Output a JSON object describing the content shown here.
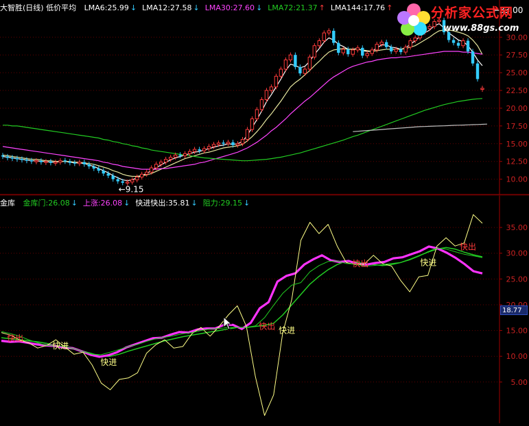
{
  "colors": {
    "background": "#000000",
    "axis": "#a00000",
    "grid": "#800000",
    "candle_up": "#ff3b3b",
    "candle_down": "#33ccff",
    "lma6": "#ffffff",
    "lma12": "#e8e8a0",
    "lma30": "#ff44ff",
    "lma72": "#22cc22",
    "lma144": "#c0c0c0",
    "gold_gate": "#22cc22",
    "rise": "#ff33ff",
    "fast_in": "#ffff88",
    "resistance": "#22cc22"
  },
  "top_header": {
    "title": "大智胜(日线) 低价平均",
    "items": [
      {
        "label": "LMA6:25.99",
        "color": "#ffffff",
        "arrow": "↓",
        "arrow_color": "#33ccff"
      },
      {
        "label": "LMA12:27.58",
        "color": "#ffffff",
        "arrow": "↓",
        "arrow_color": "#33ccff"
      },
      {
        "label": "LMA30:27.60",
        "color": "#ff44ff",
        "arrow": "↓",
        "arrow_color": "#33ccff"
      },
      {
        "label": "LMA72:21.37",
        "color": "#22cc22",
        "arrow": "↑",
        "arrow_color": "#ff3b3b"
      },
      {
        "label": "LMA144:17.76",
        "color": "#ffffff",
        "arrow": "↑",
        "arrow_color": "#ff3b3b"
      }
    ]
  },
  "bottom_header": {
    "title": "金库",
    "items": [
      {
        "label": "金库门:26.08",
        "color": "#22cc22",
        "arrow": "↓",
        "arrow_color": "#33ccff"
      },
      {
        "label": "上涨:26.08",
        "color": "#ff44ff",
        "arrow": "↓",
        "arrow_color": "#33ccff"
      },
      {
        "label": "快进快出:35.81",
        "color": "#ffffff",
        "arrow": "↓",
        "arrow_color": "#33ccff"
      },
      {
        "label": "阻力:29.15",
        "color": "#22cc22",
        "arrow": "↓",
        "arrow_color": "#33ccff"
      }
    ]
  },
  "logo": {
    "text": "分析家公式网",
    "url": "www.88gs.com"
  },
  "value_box": "18.77",
  "chart_data": [
    {
      "type": "line",
      "panel": "price",
      "title": "大智胜(日线) 低价平均",
      "ylim": [
        9.0,
        33.5
      ],
      "yticks": [
        "30.00",
        "27.50",
        "25.00",
        "22.50",
        "20.00",
        "17.50",
        "15.00",
        "12.50",
        "10.00"
      ],
      "ytick_values": [
        30.0,
        27.5,
        25.0,
        22.5,
        20.0,
        17.5,
        15.0,
        12.5,
        10.0
      ],
      "annotations": [
        {
          "text": "←9.15",
          "x_index": 25,
          "y": 9.15
        },
        {
          "text": "←33.00",
          "x_index": 103,
          "y": 33.0
        }
      ],
      "candles_close": [
        13.2,
        13.0,
        12.9,
        12.8,
        12.7,
        12.6,
        12.5,
        12.6,
        12.4,
        12.5,
        12.3,
        12.4,
        12.6,
        12.5,
        12.3,
        12.2,
        12.4,
        12.1,
        11.8,
        11.5,
        11.2,
        10.8,
        10.5,
        10.0,
        9.7,
        9.5,
        9.6,
        9.9,
        10.3,
        10.7,
        11.0,
        11.6,
        12.1,
        12.4,
        12.8,
        13.1,
        13.4,
        13.3,
        13.6,
        13.9,
        14.2,
        14.0,
        14.3,
        14.6,
        14.9,
        15.1,
        15.0,
        15.2,
        14.8,
        15.0,
        15.6,
        17.0,
        18.5,
        19.8,
        21.2,
        22.5,
        23.0,
        24.5,
        25.5,
        26.8,
        27.5,
        25.8,
        24.9,
        25.5,
        27.2,
        28.8,
        29.5,
        30.6,
        30.9,
        29.2,
        27.8,
        28.3,
        27.6,
        28.2,
        28.5,
        27.4,
        27.7,
        28.2,
        29.0,
        29.3,
        28.6,
        28.0,
        28.3,
        27.9,
        28.6,
        29.5,
        29.9,
        30.7,
        31.2,
        31.5,
        32.2,
        32.4,
        30.7,
        29.6,
        29.2,
        28.8,
        29.5,
        28.0,
        26.3,
        24.1,
        22.8
      ],
      "candles_dir": [
        "d",
        "d",
        "d",
        "d",
        "d",
        "d",
        "d",
        "u",
        "d",
        "u",
        "d",
        "u",
        "u",
        "d",
        "d",
        "d",
        "u",
        "d",
        "d",
        "d",
        "d",
        "d",
        "d",
        "d",
        "d",
        "d",
        "u",
        "u",
        "u",
        "u",
        "u",
        "u",
        "u",
        "u",
        "u",
        "u",
        "u",
        "d",
        "u",
        "u",
        "u",
        "d",
        "u",
        "u",
        "u",
        "u",
        "d",
        "u",
        "d",
        "u",
        "u",
        "u",
        "u",
        "u",
        "u",
        "u",
        "u",
        "u",
        "u",
        "u",
        "u",
        "d",
        "d",
        "u",
        "u",
        "u",
        "u",
        "u",
        "u",
        "d",
        "d",
        "u",
        "d",
        "u",
        "u",
        "d",
        "u",
        "u",
        "u",
        "u",
        "d",
        "d",
        "u",
        "d",
        "u",
        "u",
        "u",
        "u",
        "u",
        "u",
        "u",
        "u",
        "d",
        "d",
        "d",
        "d",
        "u",
        "d",
        "d",
        "d",
        "u"
      ],
      "series": [
        {
          "name": "LMA6",
          "values": [
            13.2,
            13.1,
            13.0,
            12.9,
            12.8,
            12.7,
            12.6,
            12.6,
            12.5,
            12.5,
            12.4,
            12.4,
            12.5,
            12.5,
            12.4,
            12.3,
            12.3,
            12.2,
            12.0,
            11.8,
            11.5,
            11.2,
            10.9,
            10.5,
            10.2,
            9.9,
            9.8,
            9.9,
            10.2,
            10.5,
            10.8,
            11.2,
            11.6,
            12.0,
            12.4,
            12.7,
            13.0,
            13.2,
            13.4,
            13.6,
            13.8,
            13.9,
            14.1,
            14.3,
            14.5,
            14.7,
            14.8,
            15.0,
            14.9,
            15.0,
            15.3,
            16.2,
            17.3,
            18.4,
            19.6,
            20.9,
            21.9,
            23.0,
            24.1,
            25.3,
            26.2,
            26.0,
            25.7,
            25.9,
            26.6,
            27.6,
            28.4,
            29.3,
            29.9,
            29.6,
            29.0,
            28.7,
            28.3,
            28.3,
            28.4,
            28.1,
            28.0,
            28.0,
            28.5,
            28.9,
            28.9,
            28.6,
            28.5,
            28.3,
            28.5,
            29.0,
            29.5,
            30.1,
            30.6,
            31.0,
            31.6,
            31.9,
            31.3,
            30.6,
            30.1,
            29.6,
            29.4,
            28.8,
            27.9,
            26.8,
            25.99
          ]
        },
        {
          "name": "LMA12",
          "values": [
            13.4,
            13.3,
            13.2,
            13.1,
            13.0,
            12.9,
            12.8,
            12.8,
            12.7,
            12.6,
            12.6,
            12.5,
            12.5,
            12.5,
            12.5,
            12.4,
            12.4,
            12.3,
            12.2,
            12.1,
            11.9,
            11.7,
            11.5,
            11.2,
            11.0,
            10.7,
            10.5,
            10.4,
            10.4,
            10.5,
            10.6,
            10.8,
            11.1,
            11.4,
            11.7,
            12.0,
            12.3,
            12.6,
            12.9,
            13.1,
            13.3,
            13.5,
            13.7,
            13.8,
            14.0,
            14.2,
            14.4,
            14.5,
            14.6,
            14.7,
            14.9,
            15.4,
            16.0,
            16.7,
            17.5,
            18.4,
            19.2,
            20.1,
            21.0,
            22.0,
            23.0,
            23.6,
            24.1,
            24.7,
            25.3,
            26.0,
            26.6,
            27.3,
            27.9,
            28.2,
            28.3,
            28.4,
            28.3,
            28.3,
            28.3,
            28.2,
            28.1,
            28.0,
            28.1,
            28.2,
            28.3,
            28.3,
            28.3,
            28.3,
            28.4,
            28.6,
            28.8,
            29.2,
            29.6,
            30.0,
            30.5,
            30.9,
            31.0,
            31.0,
            30.9,
            30.7,
            30.5,
            30.2,
            29.6,
            28.8,
            27.58
          ]
        },
        {
          "name": "LMA30",
          "values": [
            14.6,
            14.5,
            14.4,
            14.3,
            14.2,
            14.1,
            14.0,
            13.9,
            13.8,
            13.7,
            13.6,
            13.5,
            13.4,
            13.3,
            13.2,
            13.1,
            13.0,
            12.9,
            12.8,
            12.7,
            12.6,
            12.4,
            12.3,
            12.1,
            12.0,
            11.8,
            11.7,
            11.6,
            11.5,
            11.4,
            11.4,
            11.4,
            11.4,
            11.5,
            11.5,
            11.6,
            11.7,
            11.8,
            11.9,
            12.0,
            12.1,
            12.3,
            12.4,
            12.6,
            12.8,
            13.0,
            13.2,
            13.4,
            13.6,
            13.8,
            14.1,
            14.4,
            14.8,
            15.2,
            15.7,
            16.2,
            16.8,
            17.3,
            17.9,
            18.5,
            19.2,
            19.8,
            20.4,
            21.0,
            21.5,
            22.1,
            22.7,
            23.3,
            23.9,
            24.4,
            24.8,
            25.2,
            25.6,
            25.9,
            26.1,
            26.3,
            26.5,
            26.6,
            26.8,
            26.9,
            27.0,
            27.1,
            27.1,
            27.2,
            27.2,
            27.3,
            27.4,
            27.5,
            27.6,
            27.7,
            27.8,
            27.9,
            28.0,
            28.0,
            28.0,
            28.0,
            27.9,
            27.9,
            27.8,
            27.7,
            27.6
          ]
        },
        {
          "name": "LMA72",
          "values": [
            17.6,
            17.6,
            17.5,
            17.5,
            17.4,
            17.3,
            17.2,
            17.1,
            17.0,
            16.9,
            16.8,
            16.7,
            16.6,
            16.5,
            16.4,
            16.3,
            16.2,
            16.1,
            16.0,
            15.9,
            15.8,
            15.6,
            15.5,
            15.3,
            15.2,
            15.0,
            14.9,
            14.7,
            14.6,
            14.4,
            14.3,
            14.1,
            14.0,
            13.9,
            13.8,
            13.7,
            13.6,
            13.5,
            13.4,
            13.3,
            13.2,
            13.1,
            13.0,
            12.95,
            12.9,
            12.85,
            12.8,
            12.75,
            12.7,
            12.65,
            12.6,
            12.6,
            12.65,
            12.7,
            12.75,
            12.8,
            12.9,
            13.0,
            13.1,
            13.25,
            13.4,
            13.55,
            13.7,
            13.9,
            14.1,
            14.3,
            14.5,
            14.7,
            14.9,
            15.1,
            15.3,
            15.5,
            15.75,
            16.0,
            16.2,
            16.45,
            16.7,
            16.95,
            17.2,
            17.45,
            17.7,
            17.95,
            18.2,
            18.45,
            18.7,
            18.95,
            19.2,
            19.45,
            19.7,
            19.9,
            20.1,
            20.3,
            20.5,
            20.65,
            20.8,
            20.95,
            21.05,
            21.15,
            21.25,
            21.32,
            21.37
          ]
        },
        {
          "name": "LMA144",
          "x_start_index": 73,
          "values": [
            16.7,
            16.75,
            16.8,
            16.85,
            16.9,
            16.95,
            17.0,
            17.05,
            17.1,
            17.15,
            17.2,
            17.25,
            17.3,
            17.35,
            17.4,
            17.42,
            17.45,
            17.48,
            17.5,
            17.52,
            17.55,
            17.58,
            17.6,
            17.62,
            17.65,
            17.68,
            17.7,
            17.73,
            17.76
          ]
        }
      ]
    },
    {
      "type": "line",
      "panel": "indicator",
      "title": "金库",
      "ylim": [
        -3.0,
        39.0
      ],
      "yticks": [
        "35.00",
        "30.00",
        "25.00",
        "20.00",
        "15.00",
        "10.00",
        "5.00"
      ],
      "ytick_values": [
        35.0,
        30.0,
        25.0,
        20.0,
        15.0,
        10.0,
        5.0
      ],
      "annotations": [
        {
          "text": "快出",
          "x_index": 2,
          "y": 13.5,
          "color": "#ff3b3b"
        },
        {
          "text": "快进",
          "x_index": 18,
          "y": 12.0,
          "color": "#ffff88"
        },
        {
          "text": "快进",
          "x_index": 35,
          "y": 8.8,
          "color": "#ffff88"
        },
        {
          "text": "快出",
          "x_index": 91,
          "y": 15.8,
          "color": "#ff3b3b"
        },
        {
          "text": "快进",
          "x_index": 98,
          "y": 15.0,
          "color": "#ffff88"
        },
        {
          "text": "快出",
          "x_index": 124,
          "y": 28.0,
          "color": "#ff3b3b"
        },
        {
          "text": "快进",
          "x_index": 148,
          "y": 28.2,
          "color": "#ffff88"
        },
        {
          "text": "快出",
          "x_index": 162,
          "y": 31.2,
          "color": "#ff3b3b"
        }
      ],
      "series": [
        {
          "name": "金库门",
          "values": [
            13.6,
            13.4,
            13.2,
            13.0,
            12.8,
            12.5,
            12.0,
            11.6,
            11.4,
            11.0,
            10.5,
            10.0,
            10.0,
            10.4,
            11.0,
            11.5,
            12.0,
            12.5,
            13.0,
            13.4,
            13.8,
            14.1,
            14.4,
            14.7,
            15.0,
            15.3,
            15.6,
            15.6,
            15.8,
            16.0,
            16.4,
            18.0,
            20.0,
            22.0,
            24.0,
            25.5,
            26.8,
            27.8,
            28.5,
            28.3,
            28.0,
            27.8,
            27.6,
            27.8,
            28.2,
            28.8,
            29.5,
            30.2,
            30.8,
            31.1,
            30.8,
            30.2,
            29.7,
            29.3
          ]
        },
        {
          "name": "上涨",
          "values": [
            13.0,
            12.8,
            12.9,
            12.6,
            12.3,
            12.1,
            12.0,
            11.7,
            11.6,
            11.0,
            10.3,
            9.9,
            10.2,
            10.8,
            11.7,
            12.3,
            12.9,
            13.5,
            13.6,
            14.2,
            14.7,
            14.6,
            15.2,
            15.4,
            15.4,
            16.1,
            16.1,
            15.3,
            16.5,
            19.3,
            20.5,
            24.5,
            25.6,
            26.1,
            27.8,
            28.8,
            29.6,
            28.6,
            28.3,
            28.5,
            27.9,
            27.8,
            28.1,
            28.3,
            29.0,
            29.2,
            29.8,
            30.4,
            31.3,
            30.9,
            30.1,
            29.1,
            27.9,
            26.5,
            26.08
          ]
        },
        {
          "name": "快进快出",
          "values": [
            14.6,
            14.1,
            13.2,
            12.6,
            11.6,
            12.1,
            13.2,
            11.8,
            10.4,
            10.8,
            8.3,
            4.8,
            3.5,
            5.5,
            5.8,
            6.8,
            10.6,
            12.2,
            13.2,
            11.6,
            11.9,
            14.4,
            15.6,
            13.9,
            15.8,
            18.0,
            19.8,
            15.8,
            6.0,
            -1.5,
            2.5,
            14.5,
            21.0,
            32.5,
            36.0,
            33.8,
            35.6,
            31.4,
            28.2,
            27.8,
            27.9,
            29.6,
            28.0,
            27.5,
            24.7,
            22.5,
            25.4,
            25.7,
            31.4,
            33.0,
            31.4,
            32.0,
            37.5,
            35.81
          ]
        },
        {
          "name": "阻力",
          "values": [
            14.8,
            14.4,
            13.9,
            13.2,
            12.6,
            12.1,
            12.0,
            11.9,
            11.5,
            10.9,
            10.4,
            10.3,
            10.8,
            11.3,
            11.9,
            12.3,
            12.9,
            13.4,
            13.7,
            14.0,
            14.4,
            14.6,
            15.0,
            15.3,
            15.4,
            15.6,
            15.6,
            15.6,
            15.9,
            17.5,
            19.9,
            22.2,
            23.8,
            24.3,
            26.4,
            27.6,
            28.4,
            28.5,
            28.0,
            27.9,
            27.5,
            27.6,
            27.8,
            28.0,
            28.2,
            28.7,
            29.4,
            30.3,
            31.0,
            30.8,
            30.3,
            29.8,
            29.5,
            29.15
          ]
        }
      ]
    }
  ]
}
